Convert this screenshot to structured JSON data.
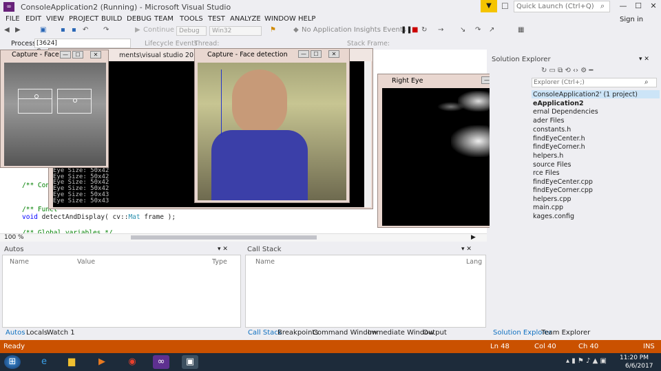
{
  "window": {
    "title": "ConsoleApplication2 (Running) - Microsoft Visual Studio",
    "quick_launch_placeholder": "Quick Launch (Ctrl+Q)",
    "sign_in": "Sign in"
  },
  "menu": [
    "FILE",
    "EDIT",
    "VIEW",
    "PROJECT",
    "BUILD",
    "DEBUG",
    "TEAM",
    "TOOLS",
    "TEST",
    "ANALYZE",
    "WINDOW",
    "HELP"
  ],
  "toolbar": {
    "continue": "Continue",
    "config": "Debug",
    "platform": "Win32",
    "insights": "No Application Insights Events"
  },
  "process_bar": {
    "process_label": "Process:",
    "process_value": "[3624] ConsoleApplication2.exe",
    "lifecycle": "Lifecycle Events",
    "thread_label": "Thread:",
    "stack_label": "Stack Frame:"
  },
  "editor": {
    "path_fragment": "ments\\visual studio 2013\\Projec",
    "code_lines": [
      {
        "text": "/** Consol",
        "kind": "comment"
      },
      {
        "text": "",
        "kind": "plain"
      },
      {
        "text": "/** Funct",
        "kind": "comment"
      },
      {
        "kw": "void",
        "rest_before": " detectAndDisplay( cv::",
        "type": "Mat",
        "rest_after": " frame );",
        "kind": "mixed"
      },
      {
        "text": "",
        "kind": "plain"
      },
      {
        "text": "/** Global variables */",
        "kind": "comment"
      }
    ],
    "zoom": "100 %"
  },
  "console": {
    "lines": [
      "Eye Size: 50x42",
      "Eye Size: 50x42",
      "Eye Size: 50x42",
      "Eye Size: 50x42",
      "Eye Size: 50x43",
      "Eye Size: 50x43"
    ]
  },
  "cv_windows": {
    "capture_face": "Capture - Face",
    "face_detection": "Capture - Face detection",
    "right_eye": "Right Eye"
  },
  "autos_panel": {
    "title": "Autos",
    "columns": [
      "Name",
      "Value",
      "Type"
    ],
    "tabs": [
      "Autos",
      "Locals",
      "Watch 1"
    ]
  },
  "callstack_panel": {
    "title": "Call Stack",
    "columns": [
      "Name",
      "Lang"
    ],
    "tabs": [
      "Call Stack",
      "Breakpoints",
      "Command Window",
      "Immediate Window",
      "Output"
    ]
  },
  "solution_explorer": {
    "title": "Solution Explorer",
    "search_placeholder": "Explorer (Ctrl+;)",
    "items": [
      "ConsoleApplication2' (1 project)",
      "eApplication2",
      "ernal Dependencies",
      "ader Files",
      "constants.h",
      "findEyeCenter.h",
      "findEyeCorner.h",
      "helpers.h",
      "source Files",
      "rce Files",
      "findEyeCenter.cpp",
      "findEyeCorner.cpp",
      "helpers.cpp",
      "main.cpp",
      "kages.config"
    ],
    "tabs": [
      "Solution Explorer",
      "Team Explorer"
    ]
  },
  "status": {
    "left": "Ready",
    "ln": "Ln 48",
    "col": "Col 40",
    "ch": "Ch 40",
    "mode": "INS"
  },
  "taskbar": {
    "time": "11:20 PM",
    "date": "6/6/2017"
  }
}
